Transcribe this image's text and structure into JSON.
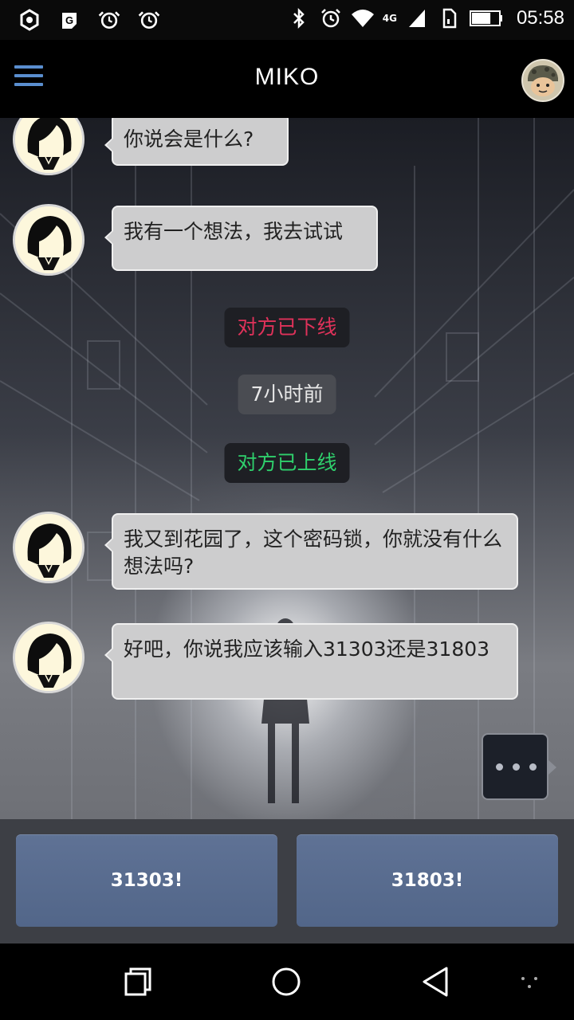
{
  "status_bar": {
    "time": "05:58",
    "network_label": "4G",
    "icons": [
      "settings-icon",
      "g-app-icon",
      "alarm-icon",
      "alarm-icon",
      "bluetooth-icon",
      "alarm-clock-icon",
      "wifi-icon",
      "signal-icon",
      "sim-icon",
      "battery-icon"
    ],
    "battery_level": 0.7
  },
  "app_bar": {
    "title": "MIKO",
    "left_icon": "menu-icon",
    "right_icon": "profile-avatar"
  },
  "messages": [
    {
      "type": "received",
      "text": "你说会是什么?"
    },
    {
      "type": "received",
      "text": "我有一个想法，我去试试"
    },
    {
      "type": "system",
      "text": "对方已下线",
      "color": "#e0325a"
    },
    {
      "type": "system",
      "text": "7小时前",
      "color": "#e8e8e8"
    },
    {
      "type": "system",
      "text": "对方已上线",
      "color": "#2fd06c"
    },
    {
      "type": "received",
      "text": "我又到花园了，这个密码锁，你就没有什么想法吗?"
    },
    {
      "type": "received",
      "text": "好吧，你说我应该输入31303还是31803"
    }
  ],
  "typing_indicator": "typing-dots-icon",
  "replies": [
    {
      "label": "31303!"
    },
    {
      "label": "31803!"
    }
  ],
  "nav_bar": {
    "icons": [
      "recent-apps-icon",
      "home-icon",
      "back-icon",
      "more-dots-icon"
    ]
  }
}
